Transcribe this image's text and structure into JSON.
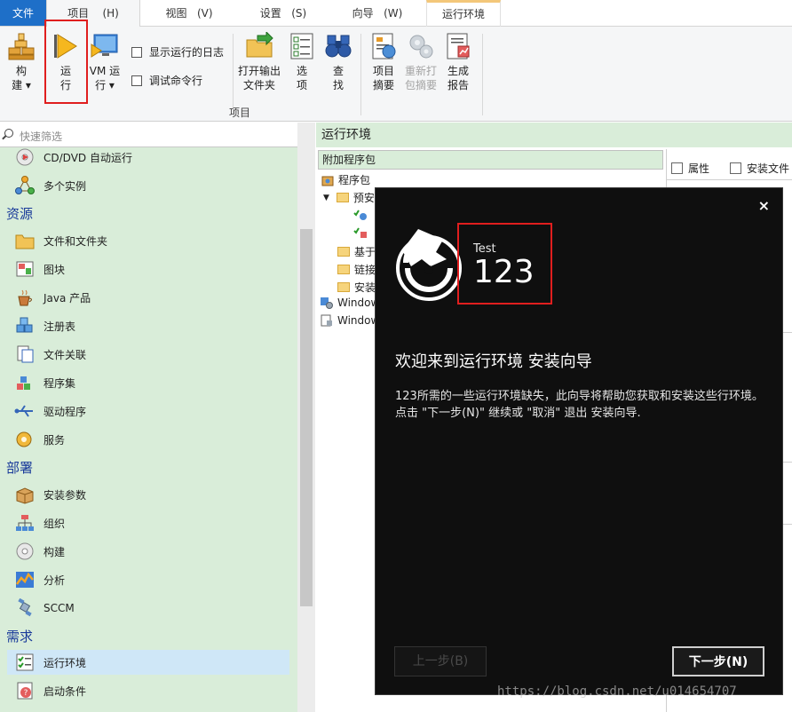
{
  "menu": {
    "tabs": [
      {
        "label": "文件"
      },
      {
        "label": "项目",
        "key": "(H)"
      },
      {
        "label": "视图",
        "key": "(V)"
      },
      {
        "label": "设置",
        "key": "(S)"
      },
      {
        "label": "向导",
        "key": "(W)"
      },
      {
        "label": "运行环境"
      }
    ]
  },
  "ribbon": {
    "build": {
      "line1": "构",
      "line2": "建"
    },
    "run": {
      "line1": "运",
      "line2": "行"
    },
    "vm": {
      "line1": "VM 运",
      "line2": "行"
    },
    "show_log": "显示运行的日志",
    "debug_cmd": "调试命令行",
    "open_output": {
      "line1": "打开输出",
      "line2": "文件夹"
    },
    "options": {
      "line1": "选",
      "line2": "项"
    },
    "find": {
      "line1": "查",
      "line2": "找"
    },
    "summary": {
      "line1": "项目",
      "line2": "摘要"
    },
    "repack": {
      "line1": "重新打",
      "line2": "包摘要"
    },
    "report": {
      "line1": "生成",
      "line2": "报告"
    },
    "group_label": "项目"
  },
  "left": {
    "filter_placeholder": "快速筛选",
    "items": [
      {
        "label": "CD/DVD 自动运行"
      },
      {
        "label": "多个实例"
      },
      {
        "label": "文件和文件夹"
      },
      {
        "label": "图块"
      },
      {
        "label": "Java 产品"
      },
      {
        "label": "注册表"
      },
      {
        "label": "文件关联"
      },
      {
        "label": "程序集"
      },
      {
        "label": "驱动程序"
      },
      {
        "label": "服务"
      },
      {
        "label": "安装参数"
      },
      {
        "label": "组织"
      },
      {
        "label": "构建"
      },
      {
        "label": "分析"
      },
      {
        "label": "SCCM"
      },
      {
        "label": "运行环境"
      },
      {
        "label": "启动条件"
      }
    ],
    "sections": [
      "资源",
      "部署",
      "需求"
    ]
  },
  "right": {
    "header": "运行环境",
    "subheader": "附加程序包",
    "tree": [
      "程序包",
      "预安",
      "基于",
      "链接",
      "安装",
      "Window",
      "Window"
    ],
    "props_tab": "属性",
    "install_tab": "安装文件"
  },
  "dialog": {
    "close": "×",
    "app_label": "Test",
    "app_name": "123",
    "title": "欢迎来到运行环境 安装向导",
    "description": "123所需的一些运行环境缺失，此向导将帮助您获取和安装这些行环境。 点击 \"下一步(N)\" 继续或 \"取消\" 退出 安装向导.",
    "prev_button": "上一步(B)",
    "next_button": "下一步(N)"
  },
  "watermark": "https://blog.csdn.net/u014654707"
}
